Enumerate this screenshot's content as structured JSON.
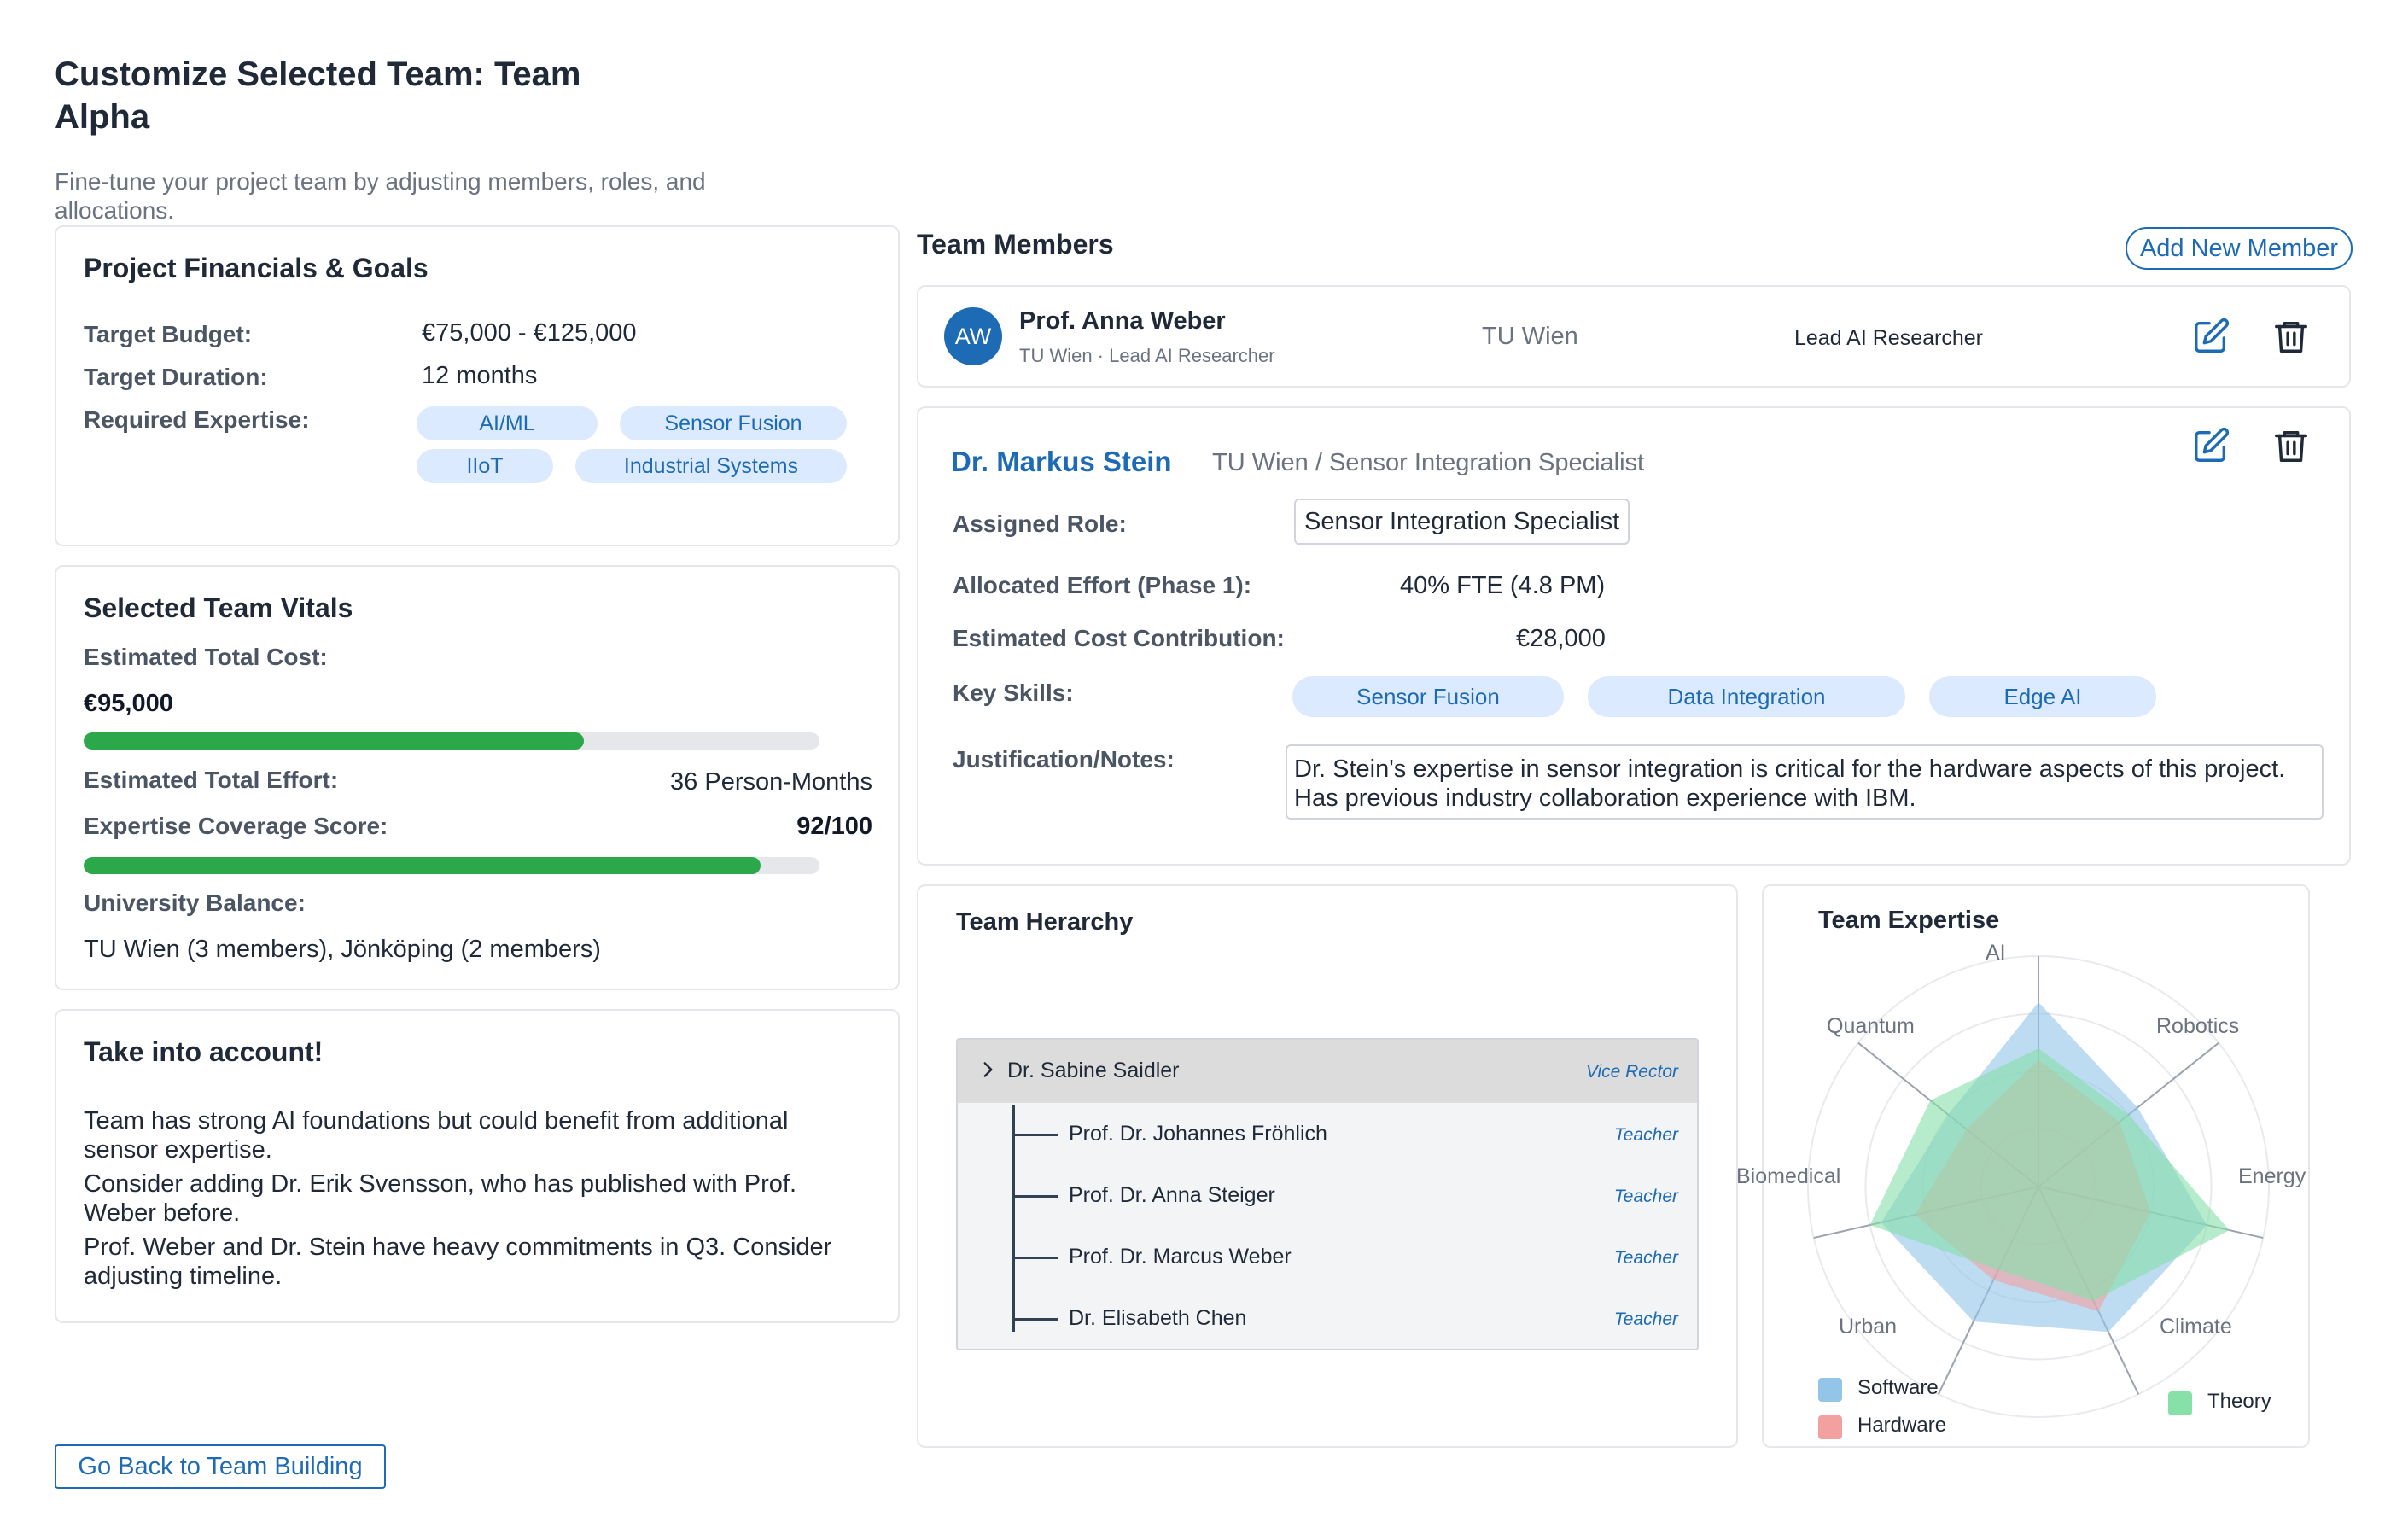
{
  "header": {
    "title": "Customize Selected Team: Team Alpha",
    "subtitle": "Fine-tune your project team by adjusting members, roles, and allocations."
  },
  "financials": {
    "title": "Project Financials & Goals",
    "budget_label": "Target Budget:",
    "budget_value": "€75,000 - €125,000",
    "duration_label": "Target Duration:",
    "duration_value": "12 months",
    "expertise_label": "Required Expertise:",
    "expertise": [
      "AI/ML",
      "Sensor Fusion",
      "IIoT",
      "Industrial Systems"
    ]
  },
  "vitals": {
    "title": "Selected Team Vitals",
    "cost_label": "Estimated Total Cost:",
    "cost_value": "€95,000",
    "cost_progress": 0.68,
    "effort_label": "Estimated Total Effort:",
    "effort_value": "36 Person-Months",
    "coverage_label": "Expertise Coverage Score:",
    "coverage_value": "92/100",
    "coverage_progress": 0.92,
    "balance_label": "University Balance:",
    "balance_value": "TU Wien (3 members), Jönköping (2 members)"
  },
  "notes": {
    "title": "Take into account!",
    "items": [
      "Team has strong AI foundations but could benefit from additional sensor expertise.",
      "Consider adding Dr. Erik Svensson, who has published with Prof. Weber before.",
      "Prof. Weber and Dr. Stein have heavy commitments in Q3. Consider adjusting timeline."
    ]
  },
  "back_button": "Go Back to Team Building",
  "members": {
    "title": "Team Members",
    "add_button": "Add New Member",
    "collapsed": {
      "initials": "AW",
      "name": "Prof. Anna Weber",
      "meta": "TU Wien · Lead AI Researcher",
      "university": "TU Wien",
      "role": "Lead AI Researcher"
    },
    "expanded": {
      "name": "Dr. Markus Stein",
      "meta": "TU Wien / Sensor Integration Specialist",
      "role_label": "Assigned Role:",
      "role_value": "Sensor Integration Specialist",
      "effort_label": "Allocated Effort (Phase 1):",
      "effort_value": "40% FTE (4.8 PM)",
      "cost_label": "Estimated Cost Contribution:",
      "cost_value": "€28,000",
      "skills_label": "Key Skills:",
      "skills": [
        "Sensor Fusion",
        "Data Integration",
        "Edge AI"
      ],
      "notes_label": "Justification/Notes:",
      "notes_value": "Dr. Stein's expertise in sensor integration is critical for the hardware aspects of this project.  Has previous industry collaboration experience with IBM."
    }
  },
  "hierarchy": {
    "title": "Team Herarchy",
    "root": {
      "name": "Dr. Sabine Saidler",
      "role": "Vice Rector"
    },
    "children": [
      {
        "name": "Prof. Dr. Johannes Fröhlich",
        "role": "Teacher"
      },
      {
        "name": "Prof. Dr. Anna Steiger",
        "role": "Teacher"
      },
      {
        "name": "Prof. Dr. Marcus Weber",
        "role": "Teacher"
      },
      {
        "name": "Dr. Elisabeth Chen",
        "role": "Teacher"
      }
    ]
  },
  "expertise_chart": {
    "title": "Team Expertise",
    "axes": [
      "AI",
      "Robotics",
      "Energy",
      "Climate",
      "Urban",
      "Biomedical",
      "Quantum"
    ],
    "colors": {
      "Software": "#93c5e8",
      "Hardware": "#f2a0a0",
      "Theory": "#86e0a8"
    }
  },
  "chart_data": {
    "type": "radar",
    "title": "Team Expertise",
    "categories": [
      "AI",
      "Robotics",
      "Energy",
      "Climate",
      "Urban",
      "Biomedical",
      "Quantum"
    ],
    "rmax": 100,
    "series": [
      {
        "name": "Software",
        "values": [
          80,
          55,
          75,
          70,
          65,
          70,
          50
        ]
      },
      {
        "name": "Hardware",
        "values": [
          55,
          45,
          50,
          60,
          45,
          55,
          40
        ]
      },
      {
        "name": "Theory",
        "values": [
          60,
          50,
          85,
          55,
          40,
          75,
          60
        ]
      }
    ]
  }
}
